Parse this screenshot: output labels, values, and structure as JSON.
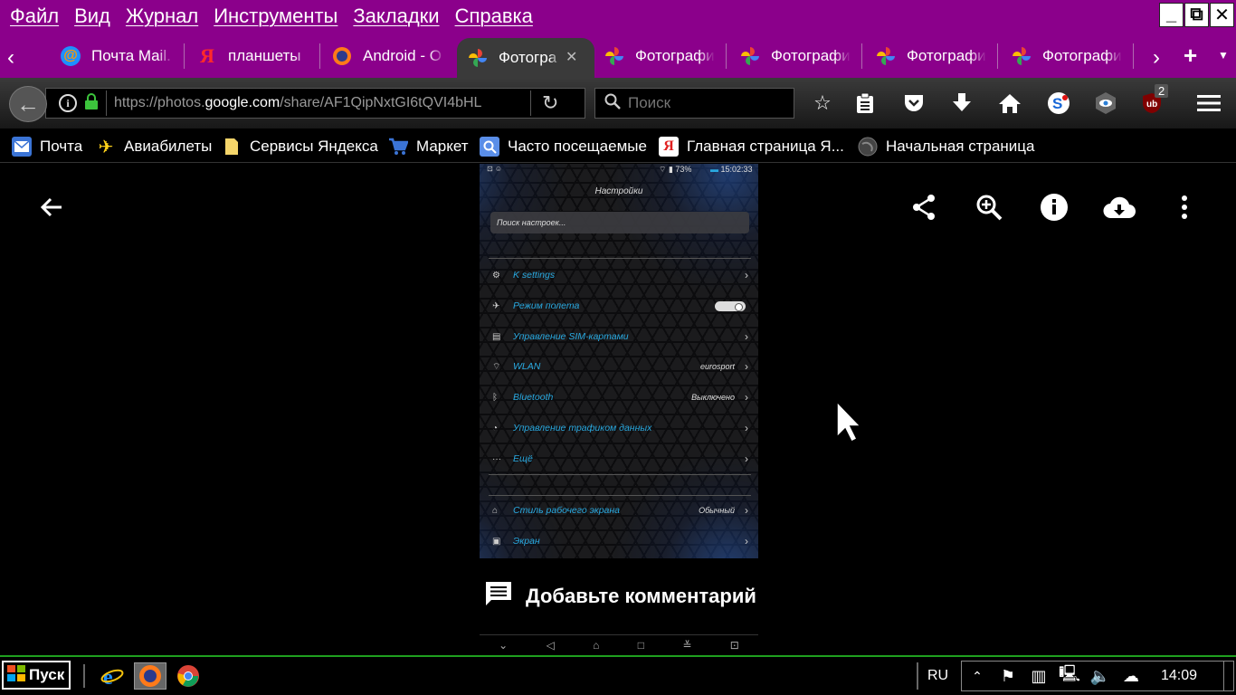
{
  "menu": [
    "Файл",
    "Вид",
    "Журнал",
    "Инструменты",
    "Закладки",
    "Справка"
  ],
  "window_controls": {
    "minimize": "_",
    "restore": "⧉",
    "close": "✕"
  },
  "tabs": [
    {
      "label": "Почта Mail.",
      "icon": "mail-ru-icon"
    },
    {
      "label": "планшеты",
      "icon": "yandex-icon"
    },
    {
      "label": "Android - O",
      "icon": "firefox-icon"
    },
    {
      "label": "Фотогра",
      "icon": "google-photos-icon",
      "active": true
    },
    {
      "label": "Фотографи",
      "icon": "google-photos-icon"
    },
    {
      "label": "Фотографи",
      "icon": "google-photos-icon"
    },
    {
      "label": "Фотографи",
      "icon": "google-photos-icon"
    },
    {
      "label": "Фотографи",
      "icon": "google-photos-icon"
    }
  ],
  "urlbar": {
    "url_prefix": "https://photos.",
    "url_domain": "google.com",
    "url_path": "/share/AF1QipNxtGI6tQVI4bHL"
  },
  "search": {
    "placeholder": "Поиск"
  },
  "toolbar": {
    "badge_count": "2"
  },
  "bookmarks": [
    {
      "label": "Почта",
      "icon": "mail-icon"
    },
    {
      "label": "Авиабилеты",
      "icon": "plane-icon"
    },
    {
      "label": "Сервисы Яндекса",
      "icon": "folder-icon"
    },
    {
      "label": "Маркет",
      "icon": "cart-icon"
    },
    {
      "label": "Часто посещаемые",
      "icon": "search-folder-icon"
    },
    {
      "label": "Главная страница Я...",
      "icon": "yandex-icon"
    },
    {
      "label": "Начальная страница",
      "icon": "globe-icon"
    }
  ],
  "phone": {
    "status": "15:02:33",
    "battery": "73%",
    "title": "Настройки",
    "search_placeholder": "Поиск настроек...",
    "rows": [
      {
        "label": "K settings",
        "value": ""
      },
      {
        "label": "Режим полета",
        "value": ""
      },
      {
        "label": "Управление SIM-картами",
        "value": ""
      },
      {
        "label": "WLAN",
        "value": "eurosport"
      },
      {
        "label": "Bluetooth",
        "value": "Выключено"
      },
      {
        "label": "Управление трафиком данных",
        "value": ""
      },
      {
        "label": "Ещё",
        "value": ""
      },
      {
        "label": "Стиль рабочего экрана",
        "value": "Обычный"
      },
      {
        "label": "Экран",
        "value": ""
      }
    ]
  },
  "comment": {
    "label": "Добавьте комментарий"
  },
  "taskbar": {
    "start_label": "Пуск",
    "language": "RU",
    "clock": "14:09"
  }
}
